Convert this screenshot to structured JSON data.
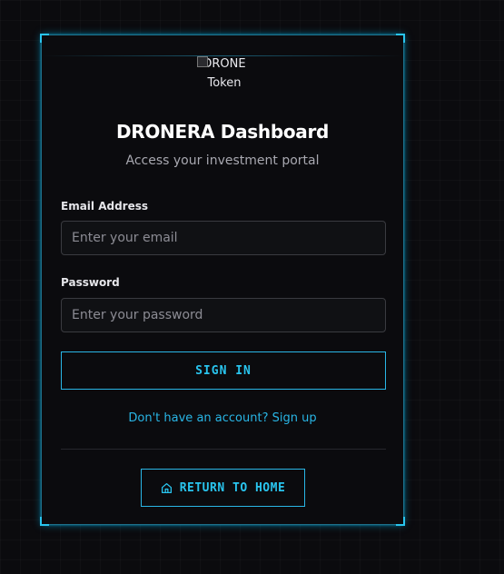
{
  "logo": {
    "alt_line1": "DRONE",
    "alt_line2": "Token"
  },
  "header": {
    "title": "DRONERA Dashboard",
    "subtitle": "Access your investment portal"
  },
  "form": {
    "email_label": "Email Address",
    "email_placeholder": "Enter your email",
    "email_value": "",
    "password_label": "Password",
    "password_placeholder": "Enter your password",
    "password_value": "",
    "submit_label": "SIGN IN",
    "signup_link": "Don't have an account? Sign up"
  },
  "footer": {
    "home_label": "RETURN TO HOME",
    "home_icon": "home-icon"
  },
  "colors": {
    "accent": "#29c4ee",
    "background": "#0b0b0e"
  }
}
